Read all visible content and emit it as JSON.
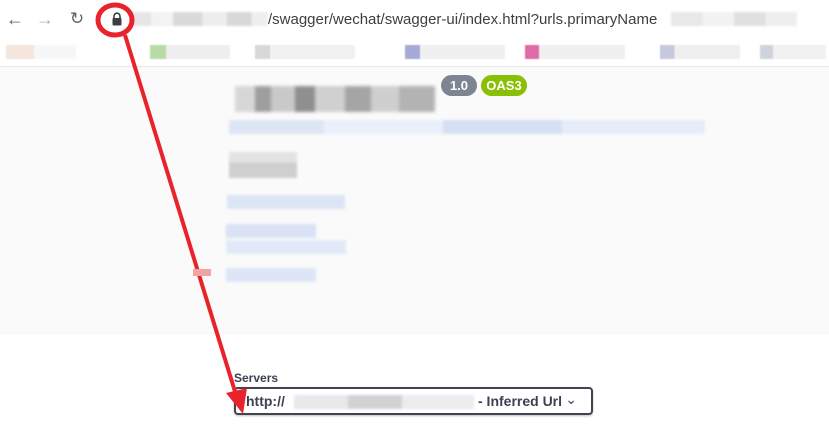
{
  "browser": {
    "back_icon": "back-arrow-icon",
    "forward_icon": "forward-arrow-icon",
    "reload_icon": "reload-icon",
    "lock_icon": "lock-icon",
    "url_visible": "/swagger/wechat/swagger-ui/index.html?urls.primaryName"
  },
  "info": {
    "version_badge": "1.0",
    "spec_badge": "OAS3"
  },
  "servers": {
    "label": "Servers",
    "selected_prefix": "http://",
    "selected_suffix": "- Inferred Url",
    "dropdown_icon": "chevron-down-icon"
  },
  "annotation": {
    "color": "#e8232b"
  },
  "colors": {
    "version_badge": "#7d8492",
    "spec_badge": "#89bf04",
    "text": "#3b4151"
  }
}
